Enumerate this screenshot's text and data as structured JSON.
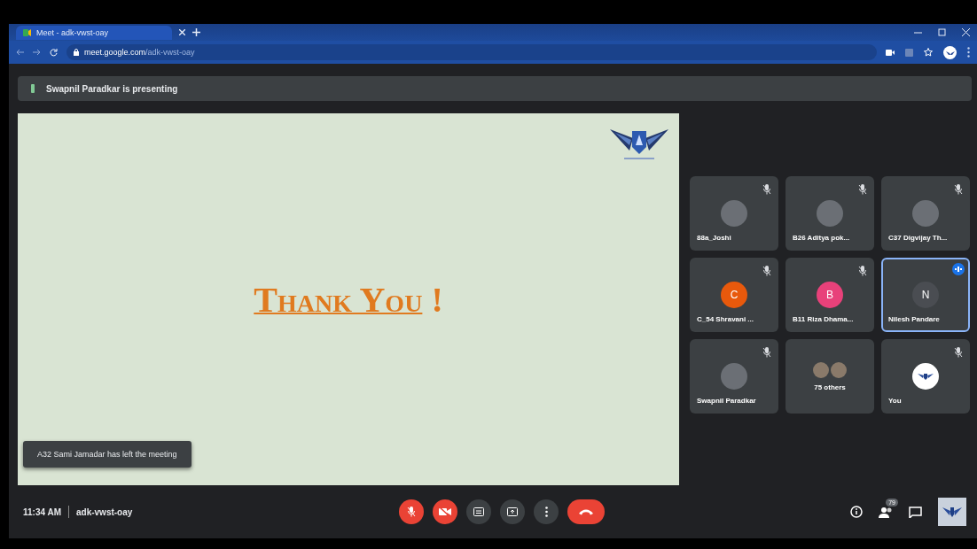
{
  "browser": {
    "tab_title": "Meet - adk-vwst-oay",
    "url_host": "meet.google.com",
    "url_path": "/adk-vwst-oay"
  },
  "banner": {
    "text": "Swapnil Paradkar is presenting"
  },
  "slide": {
    "title": "Thank You",
    "mark": "!"
  },
  "toast": {
    "text": "A32 Sami Jamadar has left the meeting"
  },
  "tiles": [
    {
      "kind": "photo",
      "name": "88a_Joshi",
      "muted": true,
      "speaking": false
    },
    {
      "kind": "photo",
      "name": "B26 Aditya pok...",
      "muted": true,
      "speaking": false
    },
    {
      "kind": "photo",
      "name": "C37 Digvijay Th...",
      "muted": true,
      "speaking": false
    },
    {
      "kind": "initial",
      "initial": "C",
      "color": "#e8590c",
      "name": "C_54 Shravani ...",
      "muted": true,
      "speaking": false
    },
    {
      "kind": "initial",
      "initial": "B",
      "color": "#e8417a",
      "name": "B11 Riza Dhama...",
      "muted": true,
      "speaking": false
    },
    {
      "kind": "initial",
      "initial": "N",
      "color": "#4a4d52",
      "name": "Nilesh Pandare",
      "muted": false,
      "speaking": true
    },
    {
      "kind": "photo",
      "name": "Swapnil Paradkar",
      "muted": true,
      "speaking": false
    },
    {
      "kind": "others",
      "name": "75 others",
      "muted": false,
      "speaking": false
    },
    {
      "kind": "logo",
      "name": "You",
      "muted": true,
      "speaking": false
    }
  ],
  "footer": {
    "time": "11:34 AM",
    "meeting_code": "adk-vwst-oay"
  },
  "controls": [
    {
      "kind": "mic",
      "on": false
    },
    {
      "kind": "camera",
      "on": false
    },
    {
      "kind": "captions",
      "on": false
    },
    {
      "kind": "present",
      "on": false
    },
    {
      "kind": "more",
      "on": false
    },
    {
      "kind": "end"
    }
  ],
  "participants_count": "79"
}
